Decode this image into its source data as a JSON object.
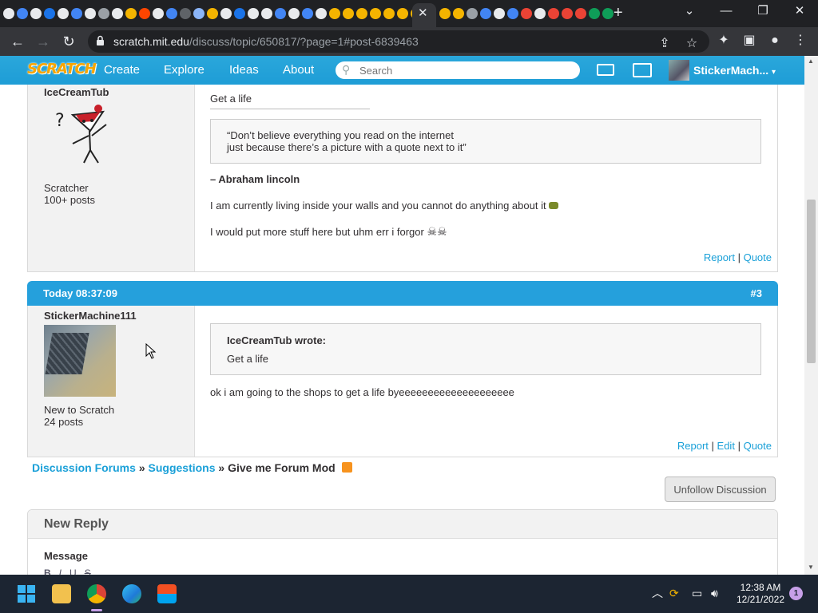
{
  "browser": {
    "url_host": "scratch.mit.edu",
    "url_path": "/discuss/topic/650817/?page=1#post-6839463",
    "tab_close": "✕",
    "new_tab": "+"
  },
  "scratch_nav": {
    "logo": "SCRATCH",
    "links": [
      "Create",
      "Explore",
      "Ideas",
      "About"
    ],
    "search_placeholder": "Search",
    "username": "StickerMach...",
    "username_caret": "▾"
  },
  "post2": {
    "author": "IceCreamTub",
    "rank": "Scratcher",
    "posts": "100+ posts",
    "text_top": "Get a life",
    "quote_line1": "“Don’t believe everything you read on the internet",
    "quote_line2": "just because there’s a picture with a quote next to it”",
    "attribution": "– Abraham lincoln",
    "sig1": "I am currently living inside your walls and you cannot do anything about it",
    "sig2": "I would put more stuff here but uhm err i forgor",
    "action_report": "Report",
    "sep": "|",
    "action_quote": "Quote"
  },
  "post3": {
    "timestamp": "Today 08:37:09",
    "number": "#3",
    "author": "StickerMachine111",
    "rank": "New to Scratch",
    "posts": "24 posts",
    "quote_author": "IceCreamTub wrote:",
    "quote_text": "Get a life",
    "text": "ok i am going to the shops to get a life byeeeeeeeeeeeeeeeeeeee",
    "action_report": "Report",
    "action_edit": "Edit",
    "action_quote": "Quote",
    "sep": "|"
  },
  "breadcrumb": {
    "forums": "Discussion Forums",
    "sep": "»",
    "category": "Suggestions",
    "topic": "Give me Forum Mod"
  },
  "unfollow_label": "Unfollow Discussion",
  "reply": {
    "title": "New Reply",
    "message_label": "Message",
    "tools": [
      "B",
      "I",
      "U",
      "S"
    ]
  },
  "taskbar": {
    "time": "12:38 AM",
    "date": "12/21/2022",
    "notifications": "1"
  }
}
